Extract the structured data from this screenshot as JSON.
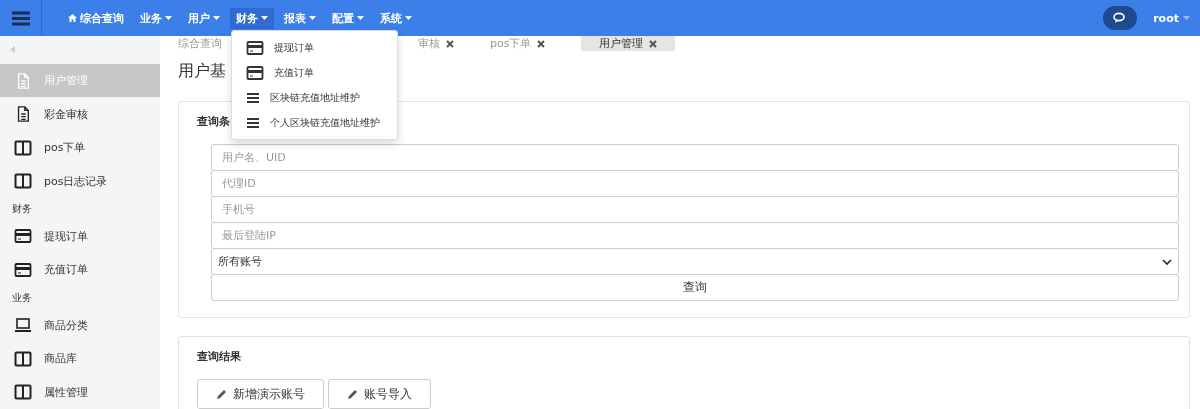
{
  "navbar": {
    "menus": [
      {
        "label": "综合查询",
        "kind": "home",
        "expanded": false
      },
      {
        "label": "业务",
        "kind": "dropdown",
        "expanded": false
      },
      {
        "label": "用户",
        "kind": "dropdown",
        "expanded": false
      },
      {
        "label": "财务",
        "kind": "dropdown",
        "expanded": true
      },
      {
        "label": "报表",
        "kind": "dropdown",
        "expanded": false
      },
      {
        "label": "配置",
        "kind": "dropdown",
        "expanded": false
      },
      {
        "label": "系统",
        "kind": "dropdown",
        "expanded": false
      }
    ],
    "user": "root"
  },
  "dropdown": {
    "items": [
      {
        "label": "提现订单"
      },
      {
        "label": "充值订单"
      },
      {
        "label": "区块链充值地址维护"
      },
      {
        "label": "个人区块链充值地址维护"
      }
    ]
  },
  "sidebar": {
    "items": [
      {
        "kind": "item",
        "label": "用户管理",
        "selected": true
      },
      {
        "kind": "item",
        "label": "彩金审核",
        "selected": false
      },
      {
        "kind": "item",
        "label": "pos下单",
        "selected": false
      },
      {
        "kind": "item",
        "label": "pos日志记录",
        "selected": false
      },
      {
        "kind": "section",
        "label": "财务"
      },
      {
        "kind": "item",
        "label": "提现订单",
        "selected": false
      },
      {
        "kind": "item",
        "label": "充值订单",
        "selected": false
      },
      {
        "kind": "section",
        "label": "业务"
      },
      {
        "kind": "item",
        "label": "商品分类",
        "selected": false
      },
      {
        "kind": "item",
        "label": "商品库",
        "selected": false
      },
      {
        "kind": "item",
        "label": "属性管理",
        "selected": false
      }
    ]
  },
  "tabs": [
    {
      "label": "综合查询",
      "selected": false
    },
    {
      "label": "审核",
      "selected": false
    },
    {
      "label": "pos下单",
      "selected": false
    },
    {
      "label": "用户管理",
      "selected": true
    }
  ],
  "page_title": "用户基",
  "query_card": {
    "title": "查询条",
    "fields": [
      {
        "placeholder": "用户名、UID"
      },
      {
        "placeholder": "代理ID"
      },
      {
        "placeholder": "手机号"
      },
      {
        "placeholder": "最后登陆IP"
      }
    ],
    "select": {
      "value": "所有账号"
    },
    "button": "查询"
  },
  "result_card": {
    "title": "查询结果",
    "buttons": [
      "新增演示账号",
      "账号导入"
    ]
  }
}
